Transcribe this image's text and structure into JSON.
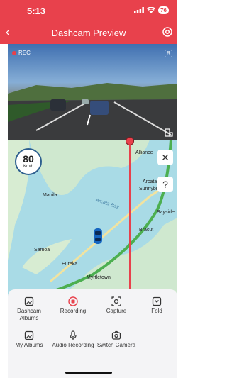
{
  "status": {
    "time": "5:13",
    "battery": "76"
  },
  "header": {
    "title": "Dashcam Preview"
  },
  "video": {
    "rec_label": "REC",
    "r_badge": "R"
  },
  "map": {
    "speed": "80",
    "speed_unit": "Km/h",
    "labels": {
      "alliance": "Alliance",
      "arcata": "Arcata",
      "sunnybrae": "Sunnybrae",
      "bayside": "Bayside",
      "manila": "Manila",
      "arcata_bay": "Arcata Bay",
      "samoa": "Samoa",
      "bracut": "Bracut",
      "eureka": "Eureka",
      "myrtletown": "Myrtletown"
    }
  },
  "actions": {
    "dashcam_albums": "Dashcam Albums",
    "recording": "Recording",
    "capture": "Capture",
    "fold": "Fold",
    "my_albums": "My Albums",
    "audio_recording": "Audio Recording",
    "switch_camera": "Switch Camera"
  },
  "colors": {
    "accent": "#e8414c",
    "water": "#a9dbe6",
    "land": "#cfe8cf",
    "route": "#4caf50"
  }
}
